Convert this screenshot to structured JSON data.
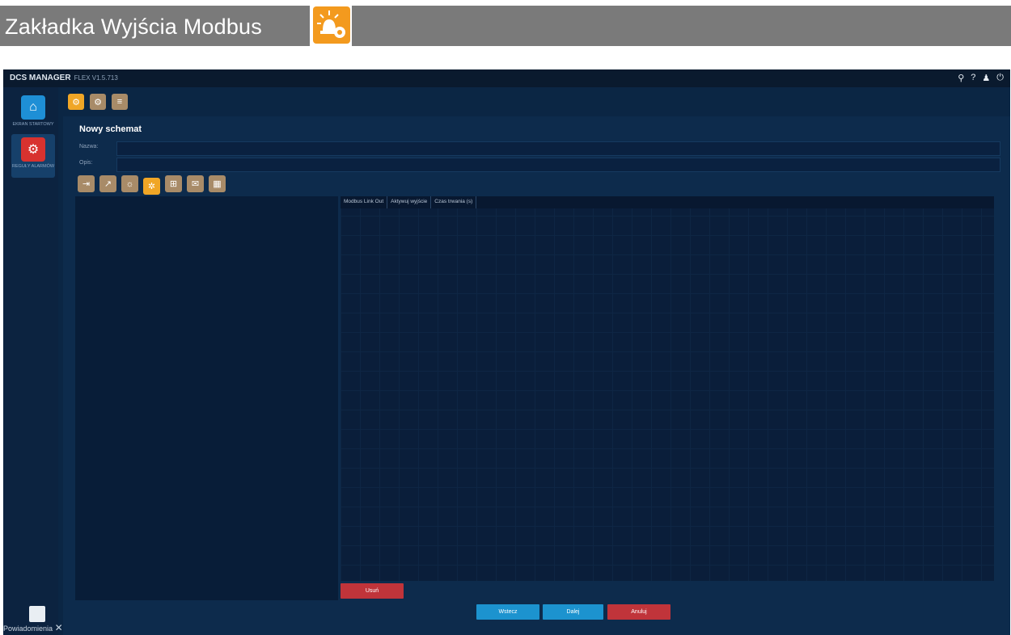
{
  "banner": {
    "title": "Zakładka Wyjścia Modbus",
    "icon": "alarm-light-gear-icon"
  },
  "app": {
    "brand": "DCS MANAGER",
    "version": "FLEX V1.5.713",
    "titlebar_icons": [
      "search-icon",
      "help-icon",
      "user-icon",
      "power-icon"
    ]
  },
  "sidebar": {
    "items": [
      {
        "label": "EKRAN STARTOWY",
        "icon": "home-icon",
        "color": "#1e8fd6"
      },
      {
        "label": "REGUŁY ALARMÓW",
        "icon": "alarm-gear-icon",
        "color": "#d8322f"
      }
    ],
    "notifications": "Powiadomienia"
  },
  "top_toolbar": {
    "icons": [
      "alarm-rule-icon",
      "alarm-settings-icon",
      "alarm-list-icon"
    ]
  },
  "form": {
    "title": "Nowy schemat",
    "name_label": "Nazwa:",
    "name_value": "",
    "desc_label": "Opis:",
    "desc_value": ""
  },
  "steps": {
    "icons": [
      "input-icon",
      "trend-icon",
      "siren-icon",
      "modbus-output-icon",
      "relay-output-icon",
      "email-icon",
      "schedule-icon"
    ],
    "selected_index": 3
  },
  "table": {
    "columns": [
      "Modbus Link Out",
      "Aktywuj wyjście",
      "Czas trwania (s)"
    ],
    "rows": []
  },
  "buttons": {
    "delete": "Usuń",
    "back": "Wstecz",
    "next": "Dalej",
    "cancel": "Anuluj"
  },
  "colors": {
    "accent": "#f0a626",
    "danger": "#c0343a",
    "primary": "#1c93cf",
    "background": "#0d2b4c"
  }
}
